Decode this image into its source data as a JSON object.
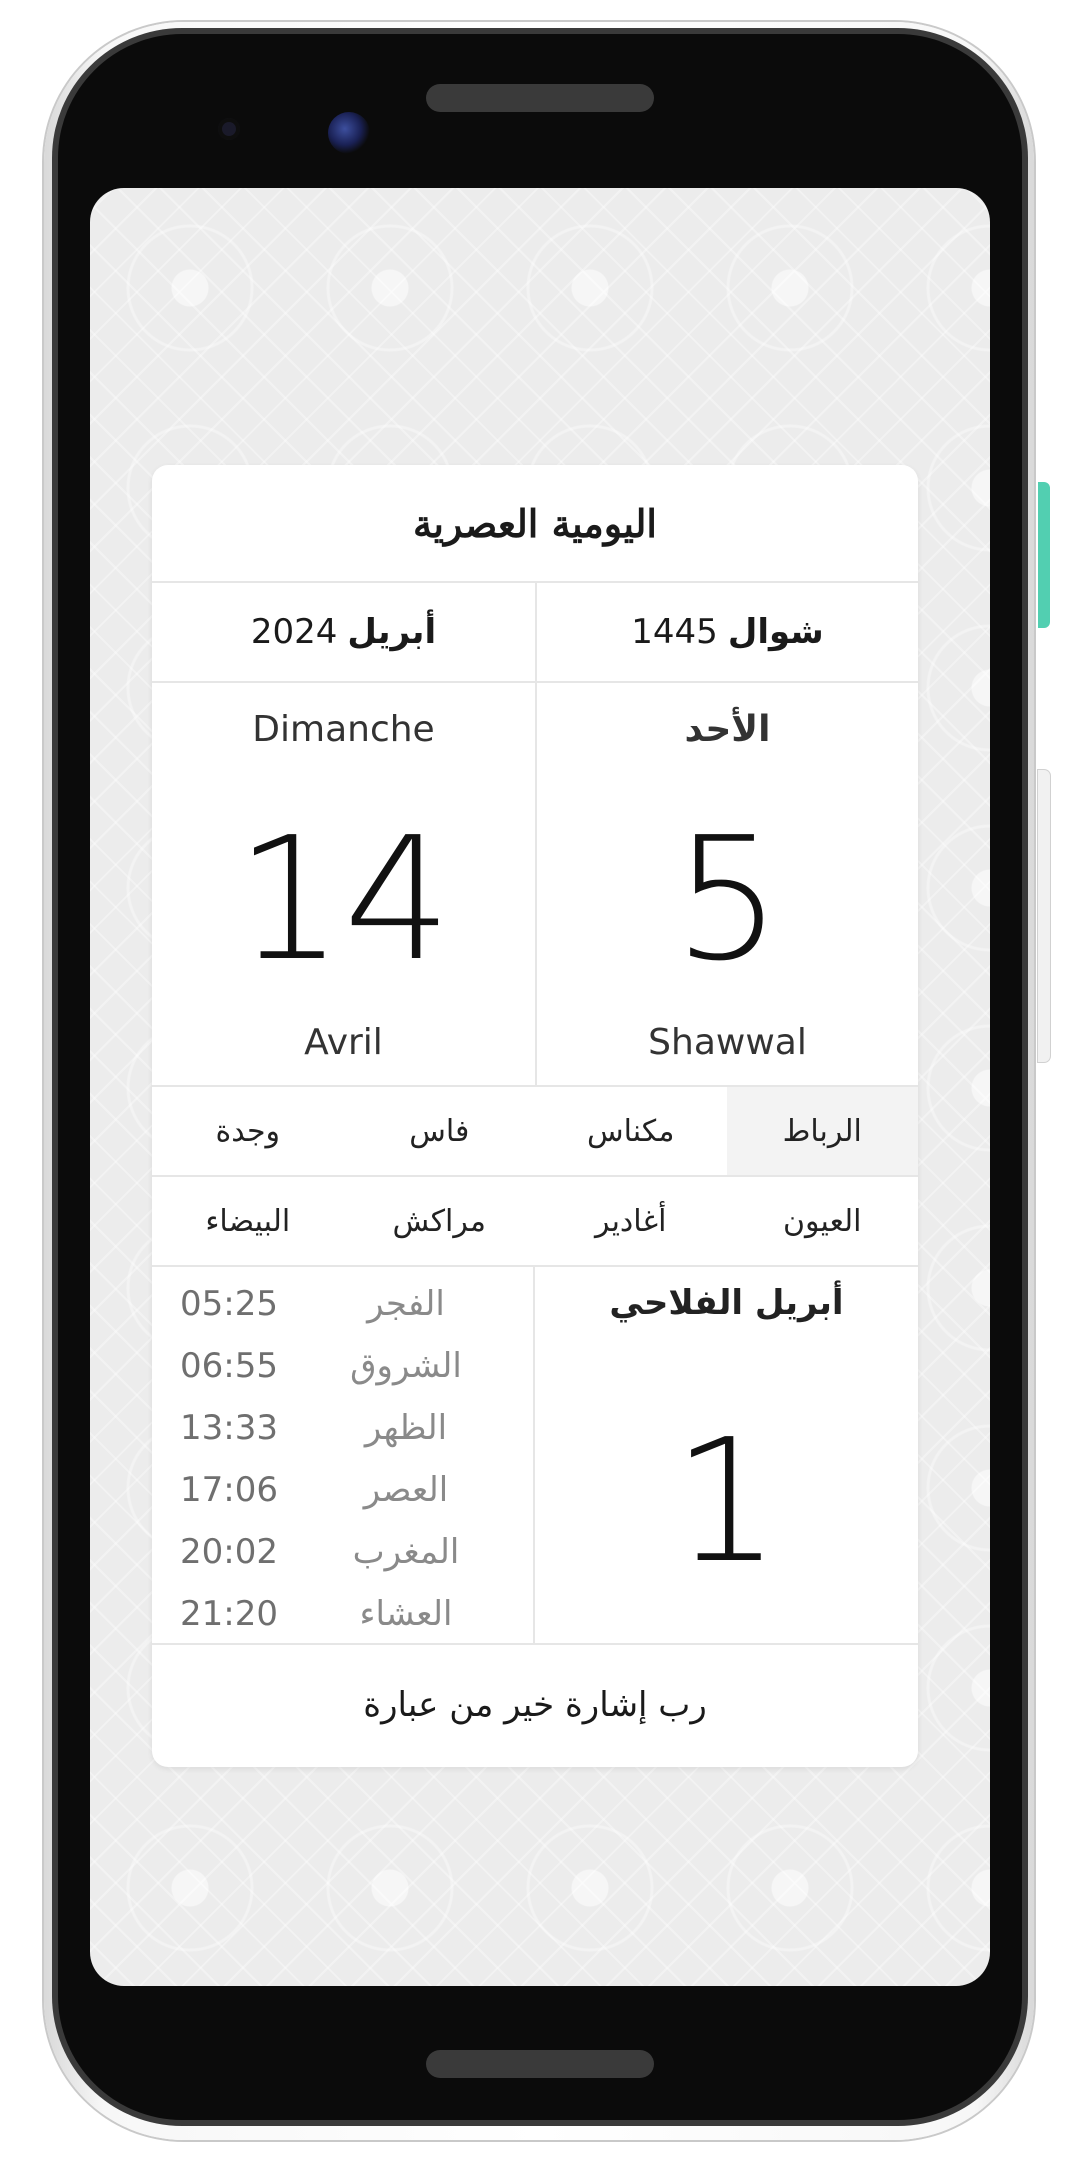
{
  "app": {
    "title": "اليومية العصرية"
  },
  "months_row": {
    "gregorian": {
      "name": "أبريل",
      "year": "2024"
    },
    "hijri": {
      "name": "شوال",
      "year": "1445"
    }
  },
  "gregorian_day": {
    "weekday": "Dimanche",
    "day": "14",
    "month": "Avril"
  },
  "hijri_day": {
    "weekday": "الأحد",
    "day": "5",
    "month": "Shawwal"
  },
  "cities": {
    "row1": [
      "الرباط",
      "مكناس",
      "فاس",
      "وجدة"
    ],
    "row2": [
      "العيون",
      "أغادير",
      "مراكش",
      "البيضاء"
    ],
    "selected": "الرباط"
  },
  "prayers": [
    {
      "name": "الفجر",
      "time": "05:25"
    },
    {
      "name": "الشروق",
      "time": "06:55"
    },
    {
      "name": "الظهر",
      "time": "13:33"
    },
    {
      "name": "العصر",
      "time": "17:06"
    },
    {
      "name": "المغرب",
      "time": "20:02"
    },
    {
      "name": "العشاء",
      "time": "21:20"
    }
  ],
  "agricultural": {
    "title": "أبريل الفلاحي",
    "day": "1"
  },
  "proverb": "رب إشارة خير من عبارة",
  "colors": {
    "accent_button": "#52cfb1",
    "card_bg": "#ffffff",
    "divider": "#e6e6e6",
    "selected_city_bg": "#f3f3f3"
  }
}
